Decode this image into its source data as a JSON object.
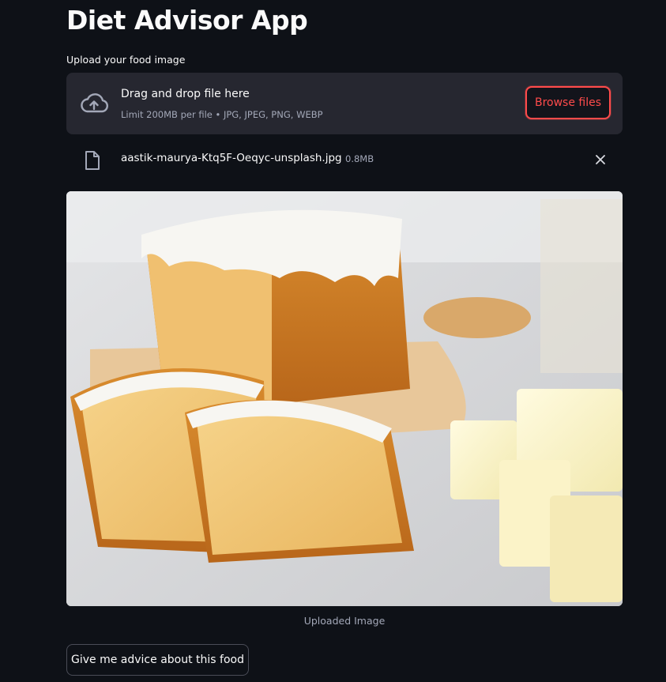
{
  "app": {
    "title": "Diet Advisor App"
  },
  "uploader": {
    "label": "Upload your food image",
    "drop_title": "Drag and drop file here",
    "drop_subtitle": "Limit 200MB per file • JPG, JPEG, PNG, WEBP",
    "browse_label": "Browse files",
    "icon": "cloud-upload-icon",
    "accent_color": "#ff4b4b"
  },
  "uploaded_file": {
    "name": "aastik-maurya-Ktq5F-Oeqyc-unsplash.jpg",
    "size": "0.8MB",
    "icon": "file-icon",
    "remove_icon": "close-icon"
  },
  "image": {
    "caption": "Uploaded Image",
    "subject": "pound cake slices with white icing and butter cubes"
  },
  "actions": {
    "advice_label": "Give me advice about this food"
  },
  "theme": {
    "background": "#0e1117",
    "surface": "#262730",
    "text": "#fafafa",
    "muted": "#a3a8b8"
  }
}
